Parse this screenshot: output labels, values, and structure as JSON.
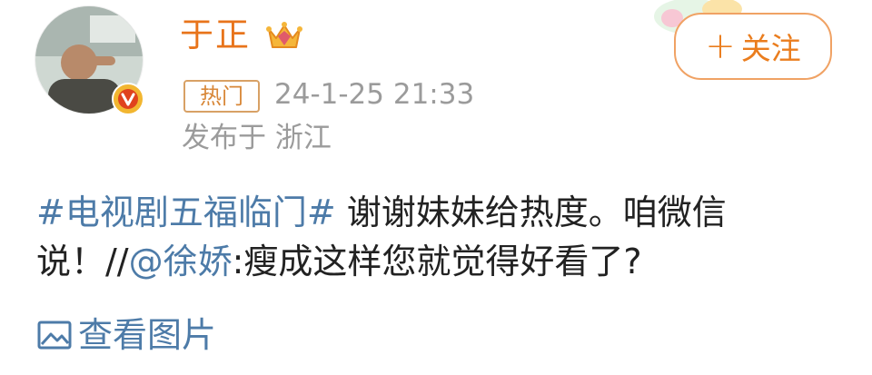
{
  "user": {
    "name": "于正",
    "verified": true
  },
  "follow_button": {
    "plus": "+",
    "label": "关注"
  },
  "post_meta": {
    "hot_badge": "热门",
    "timestamp": "24-1-25 21:33",
    "location": "发布于 浙江"
  },
  "post": {
    "topic": "#电视剧五福临门#",
    "text_part1": " 谢谢妹妹给热度。咱微信说！//",
    "mention": "@徐娇",
    "text_part2": ":瘦成这样您就觉得好看了?"
  },
  "view_images": {
    "label": "查看图片"
  },
  "colors": {
    "username": "#e8741b",
    "link": "#4d7ba8",
    "meta": "#9b9b9b",
    "follow_border": "#f0a264"
  }
}
